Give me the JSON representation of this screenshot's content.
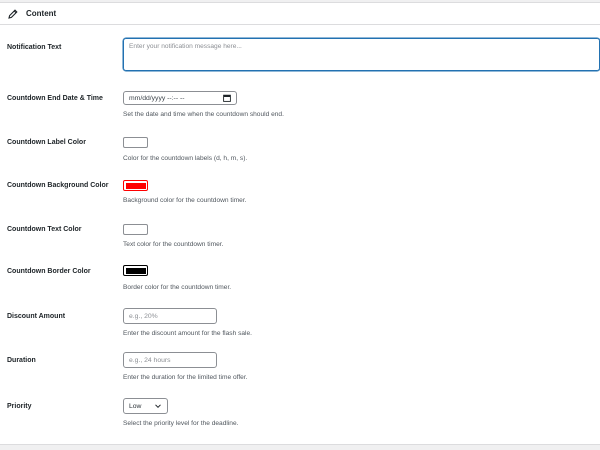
{
  "panel": {
    "title": "Content"
  },
  "fields": {
    "notification": {
      "label": "Notification Text",
      "placeholder": "Enter your notification message here..."
    },
    "end_date": {
      "label": "Countdown End Date & Time",
      "value": "mm/dd/yyyy --:-- --",
      "description": "Set the date and time when the countdown should end."
    },
    "label_color": {
      "label": "Countdown Label Color",
      "color": "#ffffff",
      "description": "Color for the countdown labels (d, h, m, s)."
    },
    "bg_color": {
      "label": "Countdown Background Color",
      "color": "#ff0000",
      "description": "Background color for the countdown timer."
    },
    "text_color": {
      "label": "Countdown Text Color",
      "color": "#ffffff",
      "description": "Text color for the countdown timer."
    },
    "border_color": {
      "label": "Countdown Border Color",
      "color": "#000000",
      "description": "Border color for the countdown timer."
    },
    "discount": {
      "label": "Discount Amount",
      "placeholder": "e.g., 20%",
      "description": "Enter the discount amount for the flash sale."
    },
    "duration": {
      "label": "Duration",
      "placeholder": "e.g., 24 hours",
      "description": "Enter the duration for the limited time offer."
    },
    "priority": {
      "label": "Priority",
      "selected": "Low",
      "description": "Select the priority level for the deadline."
    }
  },
  "icons": {
    "header": "pencil-icon",
    "date": "calendar-icon",
    "select": "chevron-down-icon"
  }
}
